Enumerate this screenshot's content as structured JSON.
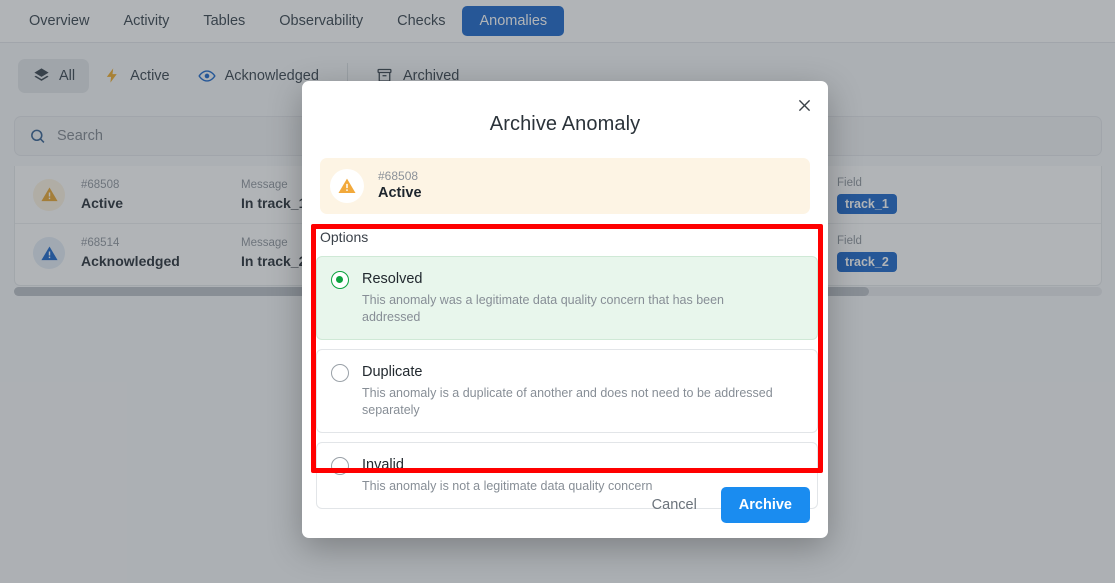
{
  "nav": {
    "tabs": [
      {
        "label": "Overview",
        "active": false
      },
      {
        "label": "Activity",
        "active": false
      },
      {
        "label": "Tables",
        "active": false
      },
      {
        "label": "Observability",
        "active": false
      },
      {
        "label": "Checks",
        "active": false
      },
      {
        "label": "Anomalies",
        "active": true
      }
    ],
    "active_accent": "#1060c9"
  },
  "filters": [
    {
      "label": "All",
      "icon": "layers-icon",
      "selected": true
    },
    {
      "label": "Active",
      "icon": "lightning-icon",
      "selected": false
    },
    {
      "label": "Acknowledged",
      "icon": "eye-icon",
      "selected": false
    },
    {
      "label": "Archived",
      "icon": "archive-icon",
      "selected": false
    }
  ],
  "search": {
    "placeholder": "Search",
    "value": "",
    "icon": "search-icon"
  },
  "table": {
    "rows": [
      {
        "icon": "warning-triangle-icon",
        "id_label": "#68508",
        "status": "Active",
        "message_label": "Message",
        "message_value": "In track_1,",
        "field_label": "Field",
        "field_tag": "track_1",
        "status_color": "#e9a227"
      },
      {
        "icon": "warning-triangle-icon",
        "id_label": "#68514",
        "status": "Acknowledged",
        "message_label": "Message",
        "message_value": "In track_2,",
        "field_label": "Field",
        "field_tag": "track_2",
        "status_color": "#1060c9"
      }
    ]
  },
  "modal": {
    "title": "Archive Anomaly",
    "close_icon": "close-icon",
    "anomaly": {
      "icon": "warning-triangle-icon",
      "id": "#68508",
      "status": "Active"
    },
    "options_label": "Options",
    "options": [
      {
        "value": "resolved",
        "title": "Resolved",
        "description": "This anomaly was a legitimate data quality concern that has been addressed",
        "selected": true
      },
      {
        "value": "duplicate",
        "title": "Duplicate",
        "description": "This anomaly is a duplicate of another and does not need to be addressed separately",
        "selected": false
      },
      {
        "value": "invalid",
        "title": "Invalid",
        "description": "This anomaly is not a legitimate data quality concern",
        "selected": false
      }
    ],
    "cancel_label": "Cancel",
    "archive_label": "Archive",
    "archive_color": "#1a8cf0",
    "selected_option_color": "#0ca33f",
    "highlight_color": "#ff0000"
  }
}
